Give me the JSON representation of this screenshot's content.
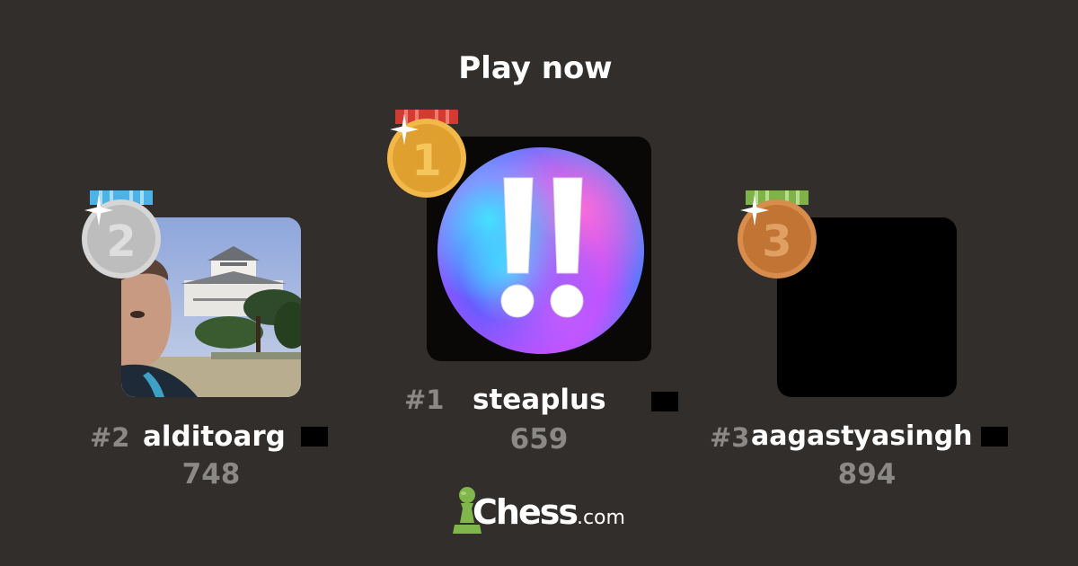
{
  "title": "Play now",
  "players": [
    {
      "place": "first",
      "rank": "#1",
      "username": "steaplus",
      "score": "659",
      "medal_number": "1",
      "medal_color": "#e6a63a",
      "ribbon_color": "#d33b32",
      "avatar": "double-exclamation-orb"
    },
    {
      "place": "second",
      "rank": "#2",
      "username": "alditoarg",
      "score": "748",
      "medal_number": "2",
      "medal_color": "#c8c8c8",
      "ribbon_color": "#4db3e6",
      "avatar": "selfie-at-castle-photo"
    },
    {
      "place": "third",
      "rank": "#3",
      "username": "aagastyasingh",
      "score": "894",
      "medal_number": "3",
      "medal_color": "#c97d3f",
      "ribbon_color": "#7fb34a",
      "avatar": "blank-black-avatar"
    }
  ],
  "brand": {
    "name": "Chess",
    "domain": ".com",
    "accent": "#81b64c"
  },
  "colors": {
    "background": "#312e2b",
    "rank_text": "#8b8987",
    "score_text": "#8b8987"
  }
}
